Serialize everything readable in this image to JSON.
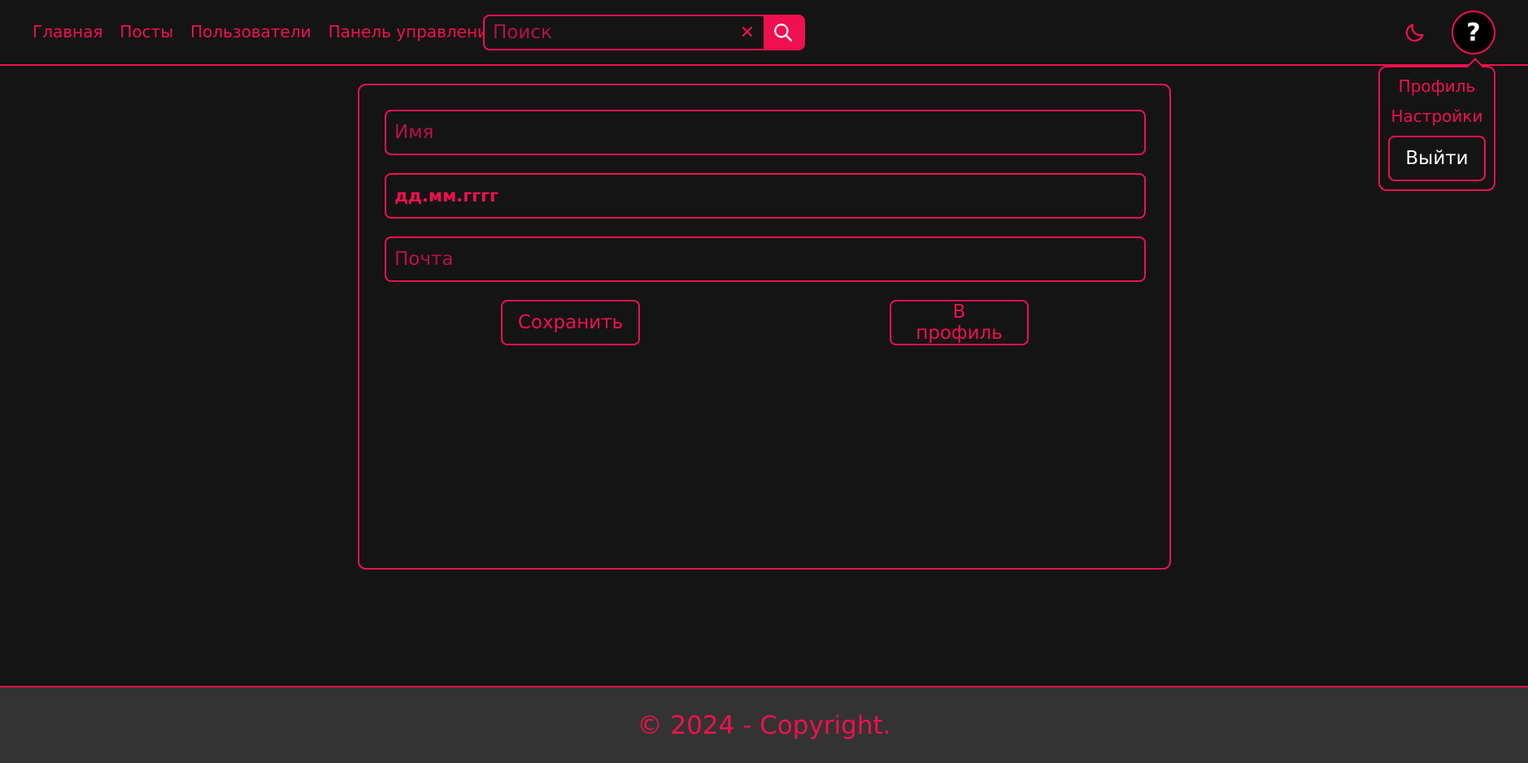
{
  "nav": {
    "items": [
      {
        "label": "Главная"
      },
      {
        "label": "Посты"
      },
      {
        "label": "Пользователи"
      },
      {
        "label": "Панель управления"
      }
    ]
  },
  "search": {
    "placeholder": "Поиск",
    "value": "",
    "clear_icon": "close-icon",
    "button_icon": "search-icon"
  },
  "header": {
    "theme_icon": "moon-icon",
    "avatar_text": "?"
  },
  "user_menu": {
    "profile_label": "Профиль",
    "settings_label": "Настройки",
    "logout_label": "Выйти"
  },
  "form": {
    "name_placeholder": "Имя",
    "name_value": "",
    "date_placeholder": "дд.мм.гггг",
    "email_placeholder": "Почта",
    "email_value": "",
    "save_label": "Сохранить",
    "profile_label": "В профиль"
  },
  "footer": {
    "text": "© 2024 - Copyright."
  },
  "colors": {
    "accent": "#f0104f",
    "background": "#141414",
    "footer_background": "#333333",
    "logout_text": "#ffffff"
  }
}
